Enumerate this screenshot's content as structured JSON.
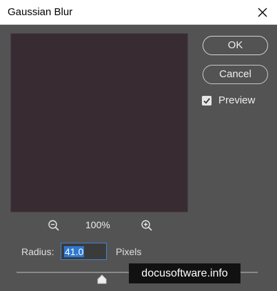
{
  "window": {
    "title": "Gaussian Blur",
    "close_icon": "close-icon"
  },
  "preview": {
    "image_color": "#392b32",
    "zoom_out_icon": "zoom-out-icon",
    "zoom_level": "100%",
    "zoom_in_icon": "zoom-in-icon"
  },
  "buttons": {
    "ok_label": "OK",
    "cancel_label": "Cancel"
  },
  "preview_option": {
    "label": "Preview",
    "checked": true
  },
  "radius": {
    "label": "Radius:",
    "value": "41.0",
    "unit": "Pixels",
    "slider_icon": "slider-thumb-icon"
  },
  "watermark": {
    "text": "docusoftware.info"
  }
}
